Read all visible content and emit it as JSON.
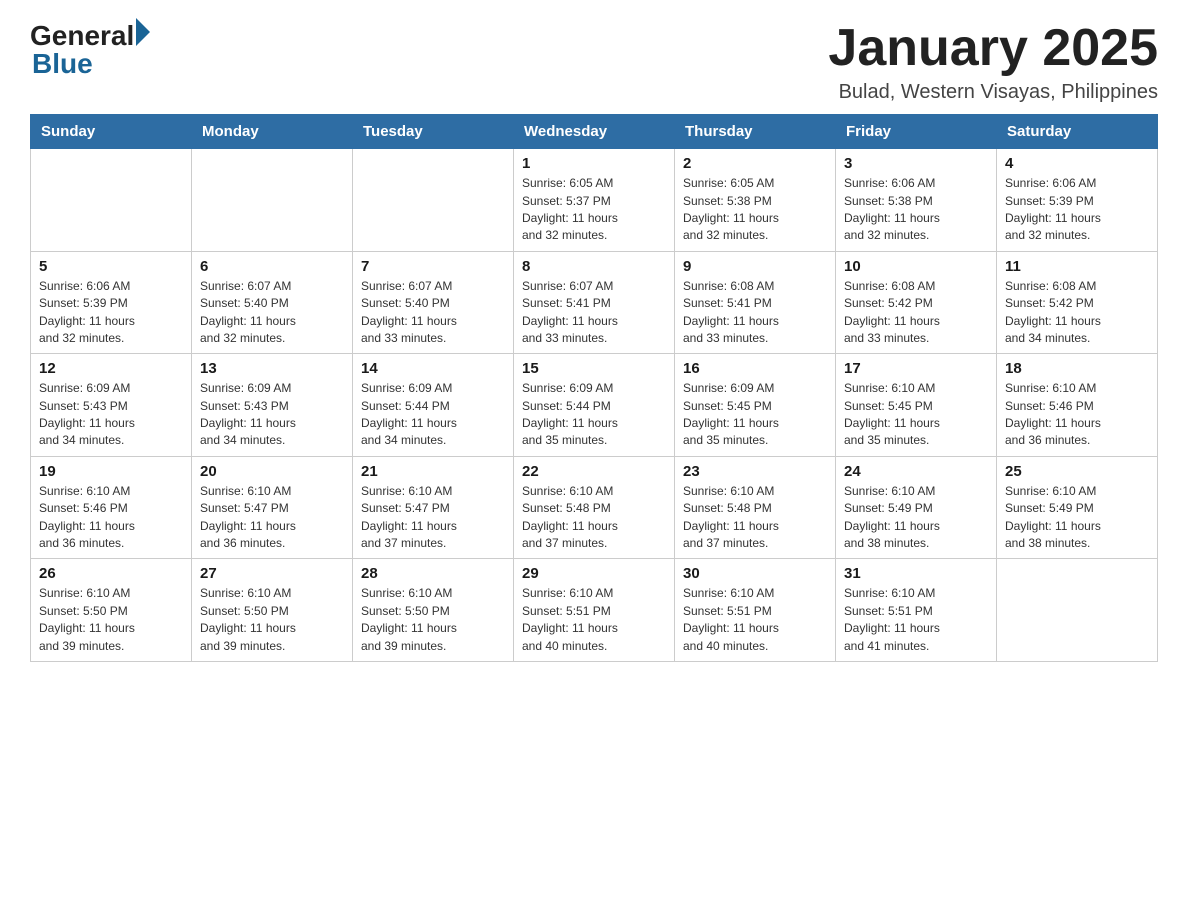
{
  "header": {
    "logo": {
      "general": "General",
      "blue": "Blue"
    },
    "title": "January 2025",
    "subtitle": "Bulad, Western Visayas, Philippines"
  },
  "calendar": {
    "weekdays": [
      "Sunday",
      "Monday",
      "Tuesday",
      "Wednesday",
      "Thursday",
      "Friday",
      "Saturday"
    ],
    "weeks": [
      [
        {
          "day": "",
          "info": ""
        },
        {
          "day": "",
          "info": ""
        },
        {
          "day": "",
          "info": ""
        },
        {
          "day": "1",
          "info": "Sunrise: 6:05 AM\nSunset: 5:37 PM\nDaylight: 11 hours\nand 32 minutes."
        },
        {
          "day": "2",
          "info": "Sunrise: 6:05 AM\nSunset: 5:38 PM\nDaylight: 11 hours\nand 32 minutes."
        },
        {
          "day": "3",
          "info": "Sunrise: 6:06 AM\nSunset: 5:38 PM\nDaylight: 11 hours\nand 32 minutes."
        },
        {
          "day": "4",
          "info": "Sunrise: 6:06 AM\nSunset: 5:39 PM\nDaylight: 11 hours\nand 32 minutes."
        }
      ],
      [
        {
          "day": "5",
          "info": "Sunrise: 6:06 AM\nSunset: 5:39 PM\nDaylight: 11 hours\nand 32 minutes."
        },
        {
          "day": "6",
          "info": "Sunrise: 6:07 AM\nSunset: 5:40 PM\nDaylight: 11 hours\nand 32 minutes."
        },
        {
          "day": "7",
          "info": "Sunrise: 6:07 AM\nSunset: 5:40 PM\nDaylight: 11 hours\nand 33 minutes."
        },
        {
          "day": "8",
          "info": "Sunrise: 6:07 AM\nSunset: 5:41 PM\nDaylight: 11 hours\nand 33 minutes."
        },
        {
          "day": "9",
          "info": "Sunrise: 6:08 AM\nSunset: 5:41 PM\nDaylight: 11 hours\nand 33 minutes."
        },
        {
          "day": "10",
          "info": "Sunrise: 6:08 AM\nSunset: 5:42 PM\nDaylight: 11 hours\nand 33 minutes."
        },
        {
          "day": "11",
          "info": "Sunrise: 6:08 AM\nSunset: 5:42 PM\nDaylight: 11 hours\nand 34 minutes."
        }
      ],
      [
        {
          "day": "12",
          "info": "Sunrise: 6:09 AM\nSunset: 5:43 PM\nDaylight: 11 hours\nand 34 minutes."
        },
        {
          "day": "13",
          "info": "Sunrise: 6:09 AM\nSunset: 5:43 PM\nDaylight: 11 hours\nand 34 minutes."
        },
        {
          "day": "14",
          "info": "Sunrise: 6:09 AM\nSunset: 5:44 PM\nDaylight: 11 hours\nand 34 minutes."
        },
        {
          "day": "15",
          "info": "Sunrise: 6:09 AM\nSunset: 5:44 PM\nDaylight: 11 hours\nand 35 minutes."
        },
        {
          "day": "16",
          "info": "Sunrise: 6:09 AM\nSunset: 5:45 PM\nDaylight: 11 hours\nand 35 minutes."
        },
        {
          "day": "17",
          "info": "Sunrise: 6:10 AM\nSunset: 5:45 PM\nDaylight: 11 hours\nand 35 minutes."
        },
        {
          "day": "18",
          "info": "Sunrise: 6:10 AM\nSunset: 5:46 PM\nDaylight: 11 hours\nand 36 minutes."
        }
      ],
      [
        {
          "day": "19",
          "info": "Sunrise: 6:10 AM\nSunset: 5:46 PM\nDaylight: 11 hours\nand 36 minutes."
        },
        {
          "day": "20",
          "info": "Sunrise: 6:10 AM\nSunset: 5:47 PM\nDaylight: 11 hours\nand 36 minutes."
        },
        {
          "day": "21",
          "info": "Sunrise: 6:10 AM\nSunset: 5:47 PM\nDaylight: 11 hours\nand 37 minutes."
        },
        {
          "day": "22",
          "info": "Sunrise: 6:10 AM\nSunset: 5:48 PM\nDaylight: 11 hours\nand 37 minutes."
        },
        {
          "day": "23",
          "info": "Sunrise: 6:10 AM\nSunset: 5:48 PM\nDaylight: 11 hours\nand 37 minutes."
        },
        {
          "day": "24",
          "info": "Sunrise: 6:10 AM\nSunset: 5:49 PM\nDaylight: 11 hours\nand 38 minutes."
        },
        {
          "day": "25",
          "info": "Sunrise: 6:10 AM\nSunset: 5:49 PM\nDaylight: 11 hours\nand 38 minutes."
        }
      ],
      [
        {
          "day": "26",
          "info": "Sunrise: 6:10 AM\nSunset: 5:50 PM\nDaylight: 11 hours\nand 39 minutes."
        },
        {
          "day": "27",
          "info": "Sunrise: 6:10 AM\nSunset: 5:50 PM\nDaylight: 11 hours\nand 39 minutes."
        },
        {
          "day": "28",
          "info": "Sunrise: 6:10 AM\nSunset: 5:50 PM\nDaylight: 11 hours\nand 39 minutes."
        },
        {
          "day": "29",
          "info": "Sunrise: 6:10 AM\nSunset: 5:51 PM\nDaylight: 11 hours\nand 40 minutes."
        },
        {
          "day": "30",
          "info": "Sunrise: 6:10 AM\nSunset: 5:51 PM\nDaylight: 11 hours\nand 40 minutes."
        },
        {
          "day": "31",
          "info": "Sunrise: 6:10 AM\nSunset: 5:51 PM\nDaylight: 11 hours\nand 41 minutes."
        },
        {
          "day": "",
          "info": ""
        }
      ]
    ]
  }
}
